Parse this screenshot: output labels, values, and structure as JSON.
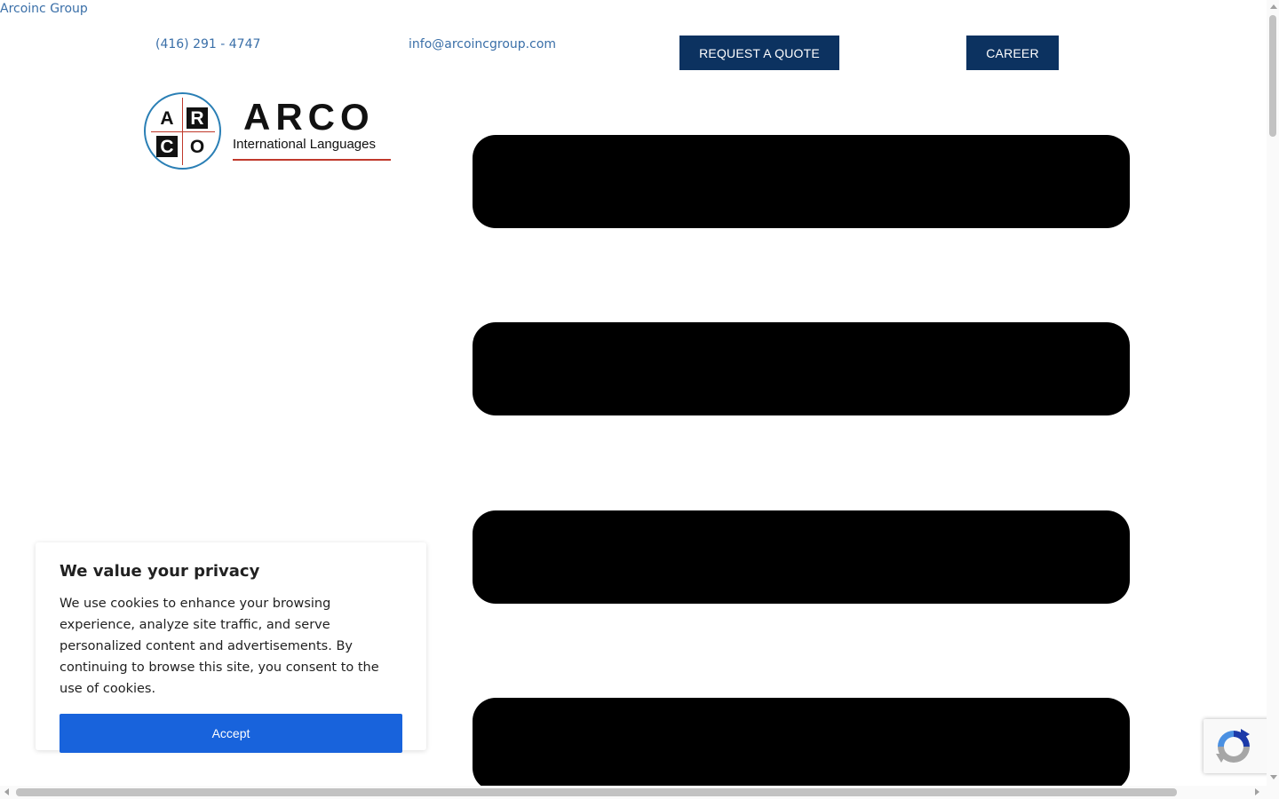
{
  "header": {
    "site_name": "Arcoinc Group",
    "phone": "(416) 291 - 4747",
    "email": "info@arcoincgroup.com",
    "request_quote_label": "REQUEST A QUOTE",
    "career_label": "CAREER",
    "button_color": "#0c3260",
    "link_color": "#3a6fa8"
  },
  "logo": {
    "cells": [
      "A",
      "R",
      "C",
      "O"
    ],
    "wordmark": "ARCO",
    "tagline": "International Languages"
  },
  "cookie_banner": {
    "title": "We value your privacy",
    "text": "We use cookies to enhance your browsing experience, analyze site traffic, and serve personalized content and advertisements. By continuing to browse this site, you consent to the use of cookies.",
    "accept_label": "Accept",
    "accept_color": "#1863dc"
  },
  "icons": {
    "recaptcha": "recaptcha-icon"
  }
}
